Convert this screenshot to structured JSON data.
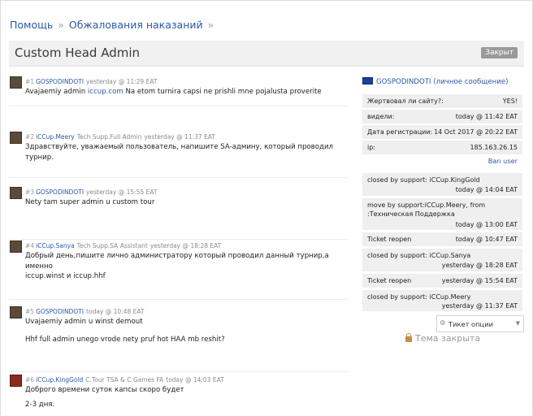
{
  "breadcrumbs": [
    "Помощь",
    "Обжалования наказаний"
  ],
  "breadcrumb_sep": "»",
  "title": "Custom Head Admin",
  "status_badge": "Закрыт",
  "posts": [
    {
      "num": "#1",
      "user": "GOSPODINDOTI",
      "role": "",
      "time": "yesterday @ 11:29 EAT",
      "text_pre": "Avajaemiy admin ",
      "link": "iccup.com",
      "text_post": " Na etom turnira capsi ne prishli mne pojalusta proverite"
    },
    {
      "num": "#2",
      "user": "iCCup.Meery",
      "role": "Tech Supp.Full Admin",
      "time": "yesterday @ 11:37 EAT",
      "text": "Здравствуйте, уважаемый пользователь, напишите SA-админу, который проводил турнир."
    },
    {
      "num": "#3",
      "user": "GOSPODINDOTI",
      "role": "",
      "time": "yesterday @ 15:55 EAT",
      "text": "Nety tam super admin u custom tour"
    },
    {
      "num": "#4",
      "user": "iCCup.Sanya",
      "role": "Tech Supp.SA Assistant",
      "time": "yesterday @ 18:28 EAT",
      "text1": "Добрый день,пишите лично администратору который проводил данный турнир,а именно",
      "text2": "iccup.winst и iccup.hhf"
    },
    {
      "num": "#5",
      "user": "GOSPODINDOTI",
      "role": "",
      "time": "today @ 10:48 EAT",
      "text1": "Uvajaemiy admin u winst demout",
      "text2": "Hhf full admin unego vrode nety pruf hot HAA mb reshit?"
    },
    {
      "num": "#6",
      "user": "iCCup.KingGold",
      "role": "C.Tour TSA & C.Games FA",
      "time": "today @ 14:03 EAT",
      "text1": "Доброго времени суток капсы скоро будет",
      "text2": "2-3 дня."
    }
  ],
  "sidebar": {
    "pm_user": "GOSPODINDOTI",
    "pm_link": "(личное сообщение)",
    "info": [
      {
        "k": "Жертвовал ли сайту?:",
        "v": "YES!"
      },
      {
        "k": "видели:",
        "v": "today @ 11:42 EAT"
      },
      {
        "k": "Дата регистрации:",
        "v": "14 Oct 2017 @ 20:22 EAT"
      },
      {
        "k": "ip:",
        "v": "185.163.26.15"
      }
    ],
    "ban_user": "Ban user",
    "log": [
      {
        "k": "closed by support: iCCup.KingGold",
        "v": "today @ 14:04 EAT"
      },
      {
        "k": "move by support:iCCup.Meery, from",
        "k2": ":Техническая Поддержка",
        "v": "today @ 13:00 EAT"
      },
      {
        "k": "Ticket reopen",
        "v": "today @ 10:47 EAT",
        "inline": true
      },
      {
        "k": "closed by support: iCCup.Sanya",
        "v": "yesterday @ 18:28 EAT"
      },
      {
        "k": "Ticket reopen",
        "v": "yesterday @ 15:54 EAT",
        "inline": true
      },
      {
        "k": "closed by support: iCCup.Meery",
        "v": "yesterday @ 11:37 EAT"
      }
    ],
    "options_label": "Тикет опции",
    "closed_label": "Тема закрыта"
  }
}
